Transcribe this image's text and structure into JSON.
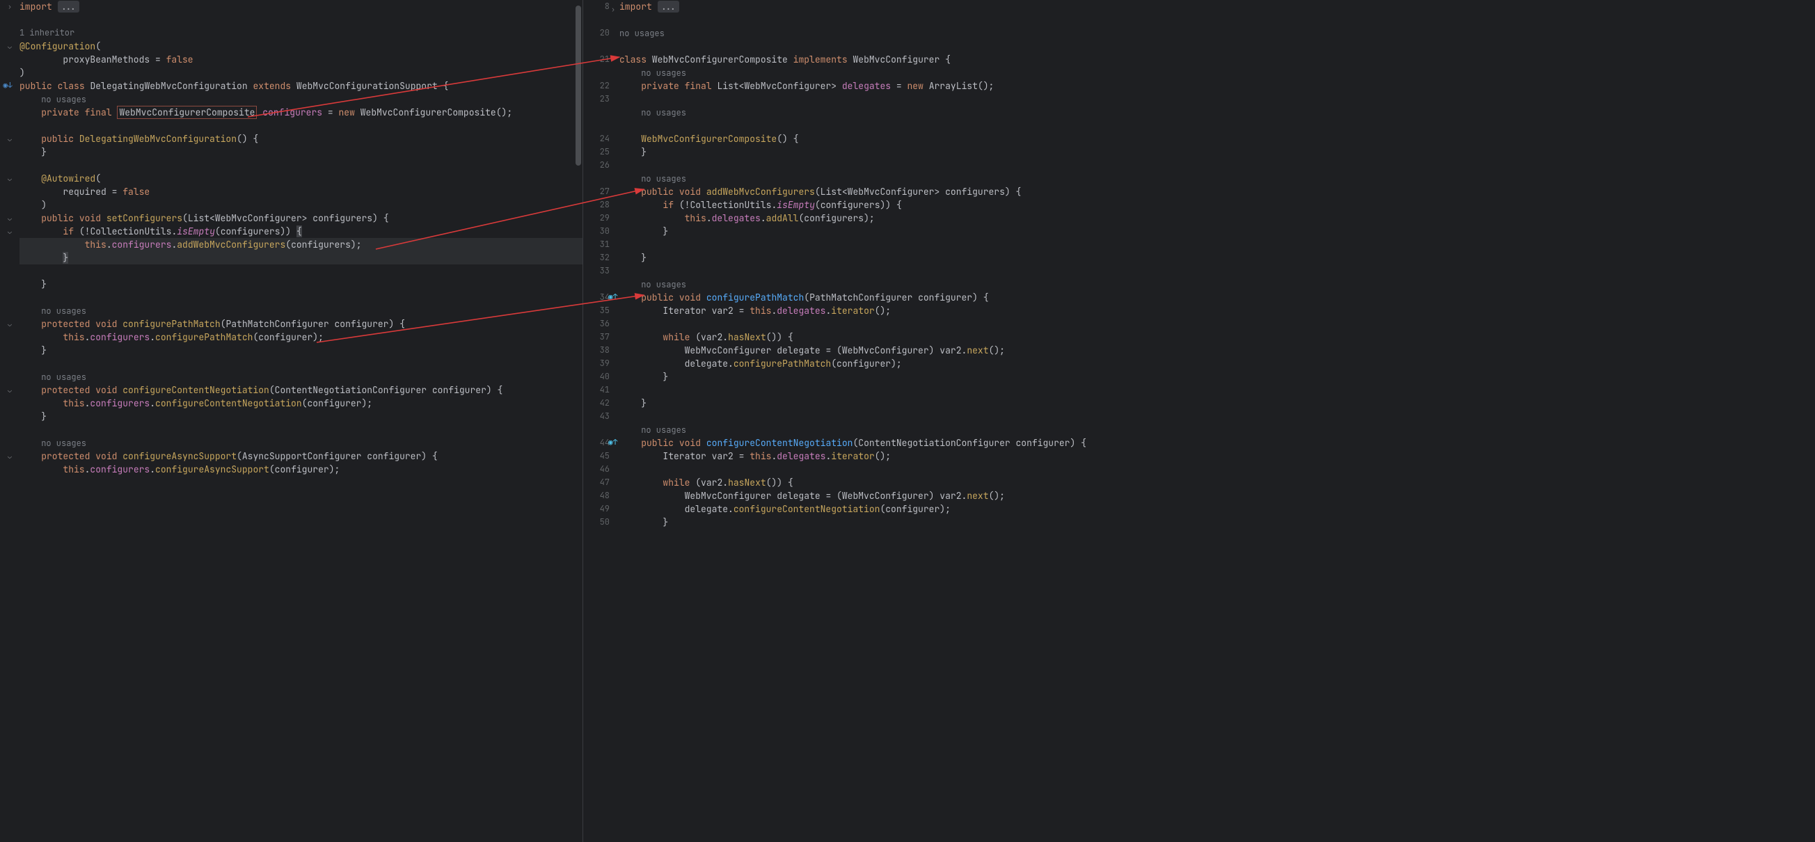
{
  "left": {
    "import_kw": "import",
    "import_ellipsis": "...",
    "inheritor_hint": "1 inheritor",
    "ann_config": "@Configuration",
    "proxy_line": "        proxyBeanMethods = ",
    "false_kw": "false",
    "public_kw": "public",
    "class_kw": "class",
    "class_name": "DelegatingWebMvcConfiguration",
    "extends_kw": "extends",
    "super_name": "WebMvcConfigurationSupport",
    "no_usages": "no usages",
    "private_kw": "private",
    "final_kw": "final",
    "wmcc_type": "WebMvcConfigurerComposite",
    "configurers_field": "configurers",
    "new_kw": "new",
    "ctor_name": "DelegatingWebMvcConfiguration",
    "ann_autowired": "@Autowired",
    "required_line": "        required = ",
    "void_kw": "void",
    "setConfigurers": "setConfigurers",
    "list_type": "List<WebMvcConfigurer>",
    "param_configurers": "configurers",
    "if_kw": "if",
    "coll_utils": "CollectionUtils",
    "isEmpty": "isEmpty",
    "this_kw": "this",
    "addWebMvcConfigurers": "addWebMvcConfigurers",
    "protected_kw": "protected",
    "configurePathMatch": "configurePathMatch",
    "pmc_type": "PathMatchConfigurer",
    "param_configurer": "configurer",
    "configureContentNegotiation": "configureContentNegotiation",
    "cnc_type": "ContentNegotiationConfigurer",
    "configureAsyncSupport": "configureAsyncSupport",
    "asc_type": "AsyncSupportConfigurer"
  },
  "right": {
    "import_kw": "import",
    "import_ellipsis": "...",
    "no_usages": "no usages",
    "class_kw": "class",
    "class_name": "WebMvcConfigurerComposite",
    "implements_kw": "implements",
    "iface_name": "WebMvcConfigurer",
    "private_kw": "private",
    "final_kw": "final",
    "list_wmc": "List<WebMvcConfigurer>",
    "delegates_field": "delegates",
    "new_kw": "new",
    "arraylist": "ArrayList",
    "ctor_name": "WebMvcConfigurerComposite",
    "public_kw": "public",
    "void_kw": "void",
    "addWebMvcConfigurers": "addWebMvcConfigurers",
    "param_configurers": "configurers",
    "if_kw": "if",
    "coll_utils": "CollectionUtils",
    "isEmpty": "isEmpty",
    "this_kw": "this",
    "addAll": "addAll",
    "configurePathMatch": "configurePathMatch",
    "pmc_type": "PathMatchConfigurer",
    "param_configurer": "configurer",
    "iterator_type": "Iterator",
    "var2": "var2",
    "iterator_m": "iterator",
    "while_kw": "while",
    "hasNext": "hasNext",
    "wmc_type": "WebMvcConfigurer",
    "delegate_var": "delegate",
    "next_m": "next",
    "configureContentNegotiation": "configureContentNegotiation",
    "cnc_type": "ContentNegotiationConfigurer",
    "linenos": [
      "8",
      "",
      "20",
      "",
      "21",
      "",
      "22",
      "23",
      "",
      "",
      "24",
      "25",
      "26",
      "",
      "27",
      "28",
      "29",
      "30",
      "31",
      "32",
      "33",
      "",
      "34",
      "35",
      "36",
      "37",
      "38",
      "39",
      "40",
      "41",
      "42",
      "43",
      "",
      "44",
      "45",
      "46",
      "47",
      "48",
      "49",
      "50"
    ]
  }
}
